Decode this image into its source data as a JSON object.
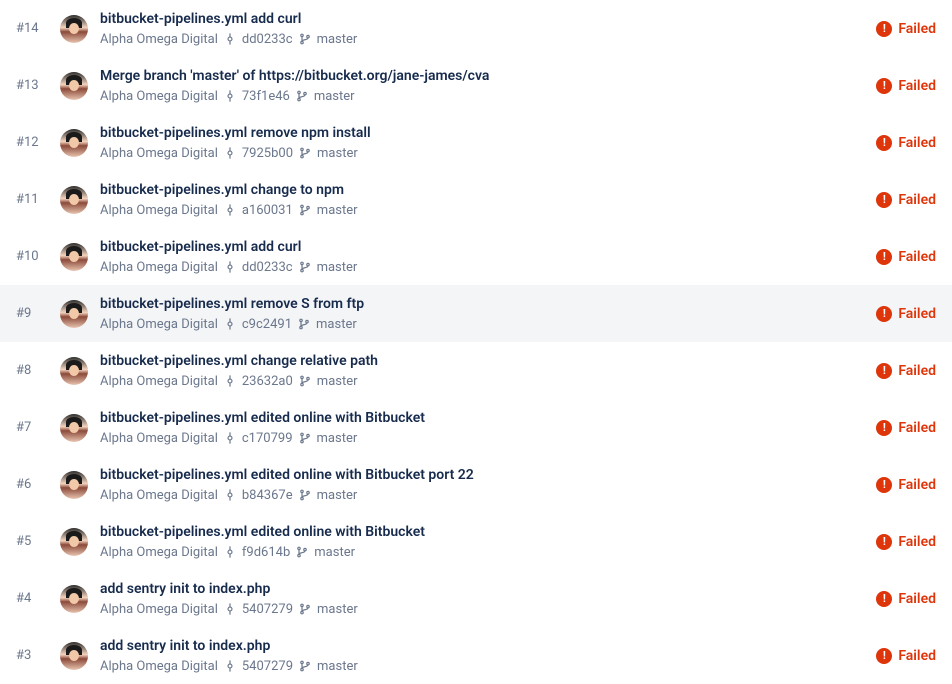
{
  "status_label": "Failed",
  "meta": {
    "author": "Alpha Omega Digital",
    "branch": "master"
  },
  "pipelines": [
    {
      "number": "#14",
      "title": "bitbucket-pipelines.yml add curl",
      "commit": "dd0233c",
      "hovered": false
    },
    {
      "number": "#13",
      "title": "Merge branch 'master' of https://bitbucket.org/jane-james/cva",
      "commit": "73f1e46",
      "hovered": false
    },
    {
      "number": "#12",
      "title": "bitbucket-pipelines.yml remove npm install",
      "commit": "7925b00",
      "hovered": false
    },
    {
      "number": "#11",
      "title": "bitbucket-pipelines.yml change to npm",
      "commit": "a160031",
      "hovered": false
    },
    {
      "number": "#10",
      "title": "bitbucket-pipelines.yml add curl",
      "commit": "dd0233c",
      "hovered": false
    },
    {
      "number": "#9",
      "title": "bitbucket-pipelines.yml remove S from ftp",
      "commit": "c9c2491",
      "hovered": true
    },
    {
      "number": "#8",
      "title": "bitbucket-pipelines.yml change relative path",
      "commit": "23632a0",
      "hovered": false
    },
    {
      "number": "#7",
      "title": "bitbucket-pipelines.yml edited online with Bitbucket",
      "commit": "c170799",
      "hovered": false
    },
    {
      "number": "#6",
      "title": "bitbucket-pipelines.yml edited online with Bitbucket port 22",
      "commit": "b84367e",
      "hovered": false
    },
    {
      "number": "#5",
      "title": "bitbucket-pipelines.yml edited online with Bitbucket",
      "commit": "f9d614b",
      "hovered": false
    },
    {
      "number": "#4",
      "title": "add sentry init to index.php",
      "commit": "5407279",
      "hovered": false
    },
    {
      "number": "#3",
      "title": "add sentry init to index.php",
      "commit": "5407279",
      "hovered": false
    }
  ]
}
